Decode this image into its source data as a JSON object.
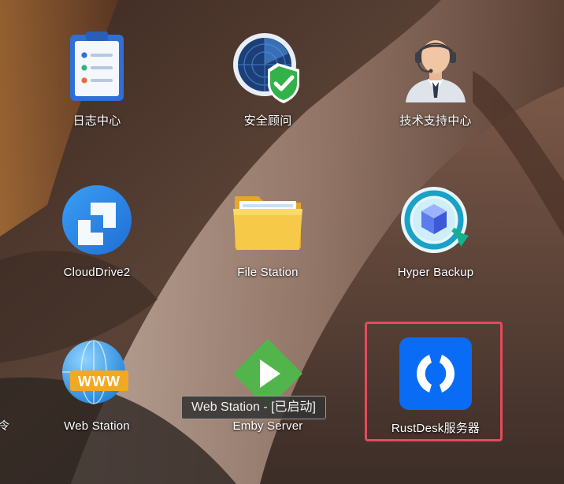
{
  "desktop": {
    "edge_label_fragment": "令",
    "apps": [
      {
        "id": "log",
        "label": "日志中心",
        "icon": "log-center-icon"
      },
      {
        "id": "security",
        "label": "安全顾问",
        "icon": "security-advisor-icon"
      },
      {
        "id": "support",
        "label": "技术支持中心",
        "icon": "support-center-icon"
      },
      {
        "id": "cloud",
        "label": "CloudDrive2",
        "icon": "clouddrive-icon"
      },
      {
        "id": "file",
        "label": "File Station",
        "icon": "folder-icon"
      },
      {
        "id": "hyper",
        "label": "Hyper Backup",
        "icon": "hyper-backup-icon"
      },
      {
        "id": "web",
        "label": "Web Station",
        "icon": "www-globe-icon"
      },
      {
        "id": "emby",
        "label": "Emby Server",
        "icon": "emby-play-icon"
      },
      {
        "id": "rust",
        "label": "RustDesk服务器",
        "icon": "rustdesk-icon"
      }
    ],
    "tooltip": "Web Station - [已启动]",
    "highlight": {
      "target": "RustDesk服务器",
      "color": "#e64a5d"
    }
  },
  "colors": {
    "accent_blue": "#1a73e8",
    "folder_yellow": "#f7c948",
    "emby_green": "#52b54b",
    "rustdesk_blue": "#0a6cf5"
  }
}
